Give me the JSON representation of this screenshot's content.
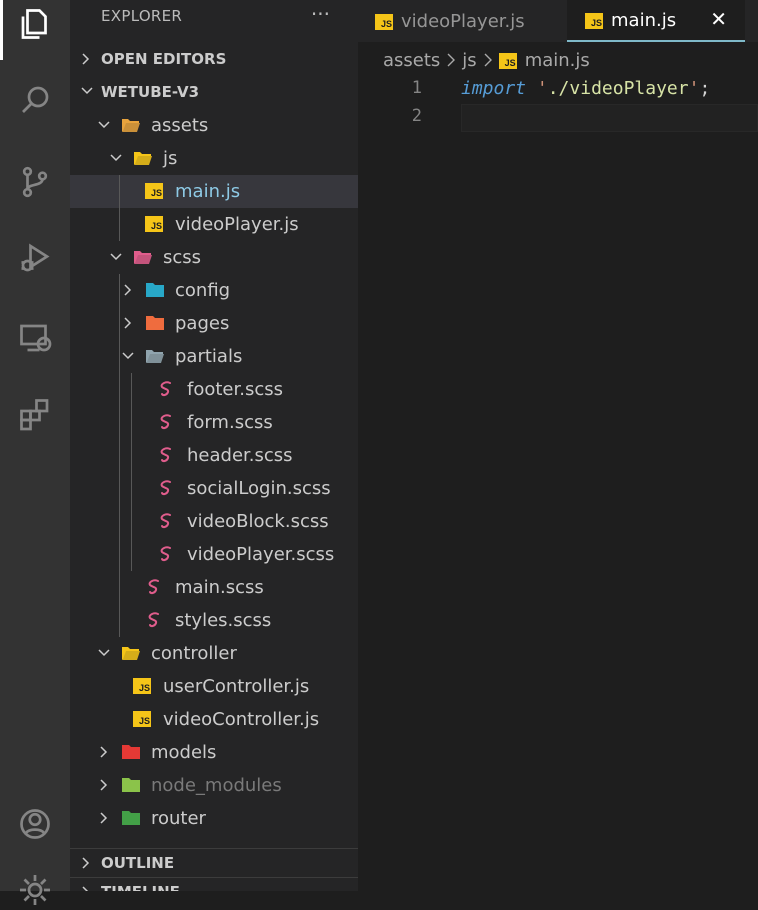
{
  "activity_bar": {
    "icons": [
      "files-icon",
      "search-icon",
      "source-control-icon",
      "run-debug-icon",
      "remote-explorer-icon",
      "extensions-icon",
      "account-icon",
      "settings-gear-icon"
    ]
  },
  "sidebar": {
    "title": "EXPLORER",
    "more": "···",
    "sections": {
      "open_editors": "OPEN EDITORS",
      "project": "WETUBE-V3",
      "outline": "OUTLINE",
      "timeline": "TIMELINE"
    },
    "tree": [
      {
        "label": "assets",
        "kind": "folder-open",
        "icon": "assets-folder-icon",
        "color": "#e8a33d"
      },
      {
        "label": "js",
        "kind": "folder-open",
        "icon": "js-folder-icon",
        "color": "#f5c518"
      },
      {
        "label": "main.js",
        "kind": "file",
        "icon": "js-file-icon"
      },
      {
        "label": "videoPlayer.js",
        "kind": "file",
        "icon": "js-file-icon"
      },
      {
        "label": "scss",
        "kind": "folder-open",
        "icon": "scss-folder-icon",
        "color": "#e05d8c"
      },
      {
        "label": "config",
        "kind": "folder-closed",
        "icon": "config-folder-icon",
        "color": "#28a8c8"
      },
      {
        "label": "pages",
        "kind": "folder-closed",
        "icon": "pages-folder-icon",
        "color": "#ef6c3e"
      },
      {
        "label": "partials",
        "kind": "folder-open",
        "icon": "folder-icon",
        "color": "#90a4ae"
      },
      {
        "label": "footer.scss",
        "kind": "file",
        "icon": "sass-file-icon"
      },
      {
        "label": "form.scss",
        "kind": "file",
        "icon": "sass-file-icon"
      },
      {
        "label": "header.scss",
        "kind": "file",
        "icon": "sass-file-icon"
      },
      {
        "label": "socialLogin.scss",
        "kind": "file",
        "icon": "sass-file-icon"
      },
      {
        "label": "videoBlock.scss",
        "kind": "file",
        "icon": "sass-file-icon"
      },
      {
        "label": "videoPlayer.scss",
        "kind": "file",
        "icon": "sass-file-icon"
      },
      {
        "label": "main.scss",
        "kind": "file",
        "icon": "sass-file-icon"
      },
      {
        "label": "styles.scss",
        "kind": "file",
        "icon": "sass-file-icon"
      },
      {
        "label": "controller",
        "kind": "folder-open",
        "icon": "controller-folder-icon",
        "color": "#f5c518"
      },
      {
        "label": "userController.js",
        "kind": "file",
        "icon": "js-file-icon"
      },
      {
        "label": "videoController.js",
        "kind": "file",
        "icon": "js-file-icon"
      },
      {
        "label": "models",
        "kind": "folder-closed",
        "icon": "models-folder-icon",
        "color": "#e53935"
      },
      {
        "label": "node_modules",
        "kind": "folder-closed",
        "icon": "node-folder-icon",
        "color": "#8bc34a"
      },
      {
        "label": "router",
        "kind": "folder-closed",
        "icon": "router-folder-icon",
        "color": "#43a047"
      }
    ]
  },
  "tabs": [
    {
      "label": "videoPlayer.js",
      "active": false,
      "icon": "js-file-icon"
    },
    {
      "label": "main.js",
      "active": true,
      "icon": "js-file-icon",
      "close": "✕"
    }
  ],
  "breadcrumb": [
    "assets",
    "js",
    "main.js"
  ],
  "editor": {
    "lines": [
      {
        "num": "1",
        "keyword": "import",
        "space": " ",
        "quote_open": "'",
        "string": "./videoPlayer",
        "quote_close": "'",
        "semicolon": ";"
      },
      {
        "num": "2"
      }
    ]
  },
  "js_badge": "JS",
  "colors": {
    "accent": "#7fb9c9",
    "sass": "#e05d8c",
    "js": "#f5c518"
  }
}
